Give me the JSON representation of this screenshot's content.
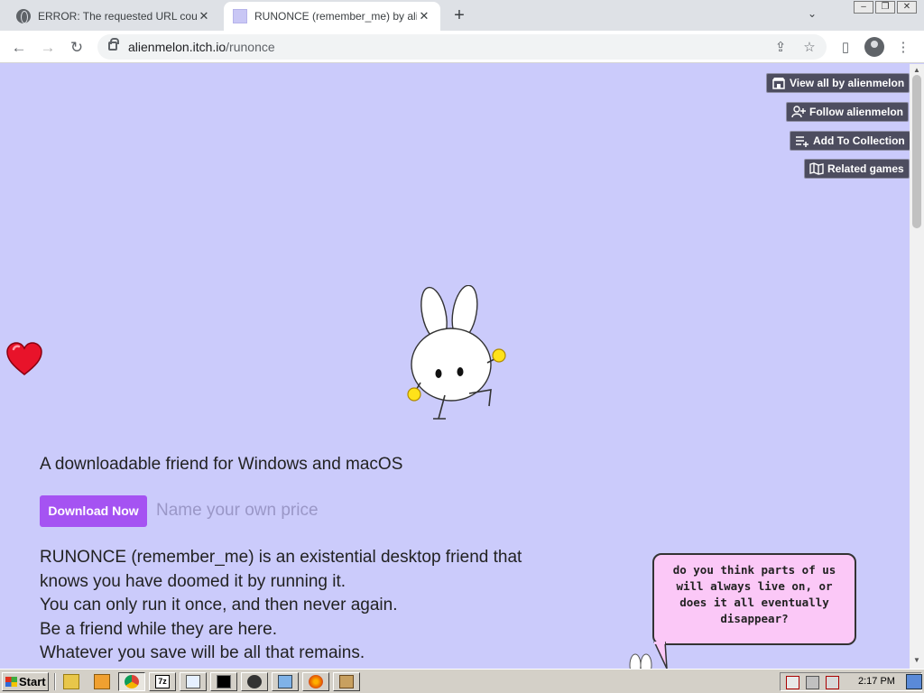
{
  "browser": {
    "tabs": [
      {
        "title": "ERROR: The requested URL could not be retrieved",
        "active": false,
        "icon": "globe-icon"
      },
      {
        "title": "RUNONCE (remember_me) by alienmelon",
        "active": true,
        "icon": "itch-favicon"
      }
    ],
    "new_tab_label": "+",
    "url_host": "alienmelon.itch.io",
    "url_path": "/runonce"
  },
  "page": {
    "top_buttons": [
      {
        "label": "View all by alienmelon",
        "icon": "store-icon"
      },
      {
        "label": "Follow alienmelon",
        "icon": "add-user-icon"
      },
      {
        "label": "Add To Collection",
        "icon": "add-list-icon"
      },
      {
        "label": "Related games",
        "icon": "map-icon"
      }
    ],
    "subtitle": "A downloadable friend for Windows and macOS",
    "download_label": "Download Now",
    "price_label": "Name your own price",
    "description": [
      "RUNONCE (remember_me) is an existential desktop friend that",
      "knows you have doomed it by running it.",
      "You can only run it once, and then never again.",
      "Be a friend while they are here.",
      "Whatever you save will be all that remains."
    ],
    "speech_bubble": "do you think parts of us will always live on, or does it all eventually disappear?"
  },
  "taskbar": {
    "start_label": "Start",
    "clock": "2:17 PM"
  },
  "colors": {
    "page_bg": "#cbcbfb",
    "download_button": "#a553f2",
    "nav_button_bg": "#4d4d5f",
    "bubble_bg": "#fbc8f7"
  }
}
